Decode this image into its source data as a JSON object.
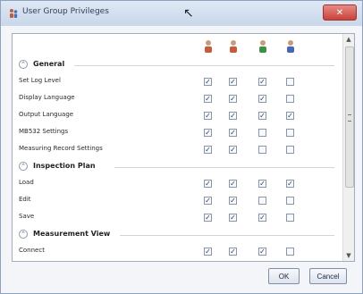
{
  "window": {
    "title": "User Group Privileges",
    "icon": "users-icon",
    "close_icon": "close-icon"
  },
  "columns": [
    {
      "icon": "user-group-1-icon",
      "color": "#c65a3a"
    },
    {
      "icon": "user-group-2-icon",
      "color": "#c65a3a"
    },
    {
      "icon": "user-group-3-icon",
      "color": "#3d8f45"
    },
    {
      "icon": "user-group-4-icon",
      "color": "#4965b8"
    }
  ],
  "sections": [
    {
      "label": "General",
      "rows": [
        {
          "label": "Set Log Level",
          "checked": [
            true,
            true,
            true,
            false
          ]
        },
        {
          "label": "Display Language",
          "checked": [
            true,
            true,
            true,
            false
          ]
        },
        {
          "label": "Output Language",
          "checked": [
            true,
            true,
            true,
            true
          ]
        },
        {
          "label": "MB532 Settings",
          "checked": [
            true,
            true,
            false,
            false
          ]
        },
        {
          "label": "Measuring Record Settings",
          "checked": [
            true,
            true,
            false,
            false
          ]
        }
      ]
    },
    {
      "label": "Inspection Plan",
      "rows": [
        {
          "label": "Load",
          "checked": [
            true,
            true,
            true,
            true
          ]
        },
        {
          "label": "Edit",
          "checked": [
            true,
            true,
            false,
            false
          ]
        },
        {
          "label": "Save",
          "checked": [
            true,
            true,
            true,
            false
          ]
        }
      ]
    },
    {
      "label": "Measurement View",
      "rows": [
        {
          "label": "Connect",
          "checked": [
            true,
            true,
            true,
            false
          ]
        }
      ]
    }
  ],
  "buttons": {
    "ok": "OK",
    "cancel": "Cancel"
  },
  "scrollbar": {
    "up_glyph": "▲",
    "down_glyph": "▼"
  }
}
